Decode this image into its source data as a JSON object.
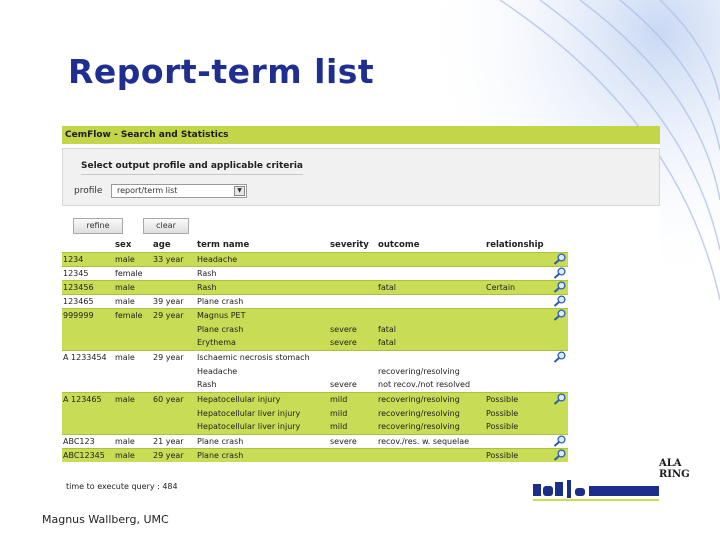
{
  "slide": {
    "title": "Report-term list",
    "footer": "Magnus Wallberg, UMC",
    "logo_lines": [
      "ALA",
      "RING"
    ]
  },
  "app": {
    "title": "CemFlow - Search and Statistics",
    "criteria_title": "Select output profile and applicable criteria",
    "profile_label": "profile",
    "profile_value": "report/term list",
    "refine_label": "refine",
    "clear_label": "clear",
    "exec_time": "time to execute query : 484",
    "accent_color": "#c9dc55"
  },
  "table": {
    "headers": [
      "",
      "sex",
      "age",
      "term name",
      "severity",
      "outcome",
      "relationship"
    ],
    "rows": [
      {
        "id": "1234",
        "sex": "male",
        "age": "33 year",
        "term": "Headache",
        "severity": "",
        "outcome": "",
        "relationship": "",
        "shade": "g",
        "icon": true
      },
      {
        "id": "12345",
        "sex": "female",
        "age": "",
        "term": "Rash",
        "severity": "",
        "outcome": "",
        "relationship": "",
        "shade": "w",
        "icon": true
      },
      {
        "id": "123456",
        "sex": "male",
        "age": "",
        "term": "Rash",
        "severity": "",
        "outcome": "fatal",
        "relationship": "Certain",
        "shade": "g",
        "icon": true
      },
      {
        "id": "123465",
        "sex": "male",
        "age": "39 year",
        "term": "Plane crash",
        "severity": "",
        "outcome": "",
        "relationship": "",
        "shade": "w",
        "icon": true
      },
      {
        "id": "999999",
        "sex": "female",
        "age": "29 year",
        "term": "Magnus PET",
        "severity": "",
        "outcome": "",
        "relationship": "",
        "shade": "g",
        "icon": true
      },
      {
        "id": "",
        "sex": "",
        "age": "",
        "term": "Plane crash",
        "severity": "severe",
        "outcome": "fatal",
        "relationship": "",
        "shade": "g",
        "icon": false
      },
      {
        "id": "",
        "sex": "",
        "age": "",
        "term": "Erythema",
        "severity": "severe",
        "outcome": "fatal",
        "relationship": "",
        "shade": "g",
        "icon": false
      },
      {
        "id": "A 1233454",
        "sex": "male",
        "age": "29 year",
        "term": "Ischaemic necrosis stomach",
        "severity": "",
        "outcome": "",
        "relationship": "",
        "shade": "w",
        "icon": true
      },
      {
        "id": "",
        "sex": "",
        "age": "",
        "term": "Headache",
        "severity": "",
        "outcome": "recovering/resolving",
        "relationship": "",
        "shade": "w",
        "icon": false
      },
      {
        "id": "",
        "sex": "",
        "age": "",
        "term": "Rash",
        "severity": "severe",
        "outcome": "not recov./not resolved",
        "relationship": "",
        "shade": "w",
        "icon": false
      },
      {
        "id": "A 123465",
        "sex": "male",
        "age": "60 year",
        "term": "Hepatocellular injury",
        "severity": "mild",
        "outcome": "recovering/resolving",
        "relationship": "Possible",
        "shade": "g",
        "icon": true
      },
      {
        "id": "",
        "sex": "",
        "age": "",
        "term": "Hepatocellular liver injury",
        "severity": "mild",
        "outcome": "recovering/resolving",
        "relationship": "Possible",
        "shade": "g",
        "icon": false
      },
      {
        "id": "",
        "sex": "",
        "age": "",
        "term": "Hepatocellular liver injury",
        "severity": "mild",
        "outcome": "recovering/resolving",
        "relationship": "Possible",
        "shade": "g",
        "icon": false
      },
      {
        "id": "ABC123",
        "sex": "male",
        "age": "21 year",
        "term": "Plane crash",
        "severity": "severe",
        "outcome": "recov./res. w. sequelae",
        "relationship": "",
        "shade": "w",
        "icon": true
      },
      {
        "id": "ABC12345",
        "sex": "male",
        "age": "29 year",
        "term": "Plane crash",
        "severity": "",
        "outcome": "",
        "relationship": "Possible",
        "shade": "g",
        "icon": true
      }
    ]
  },
  "icons": {
    "row_action": "magnifier-icon"
  }
}
